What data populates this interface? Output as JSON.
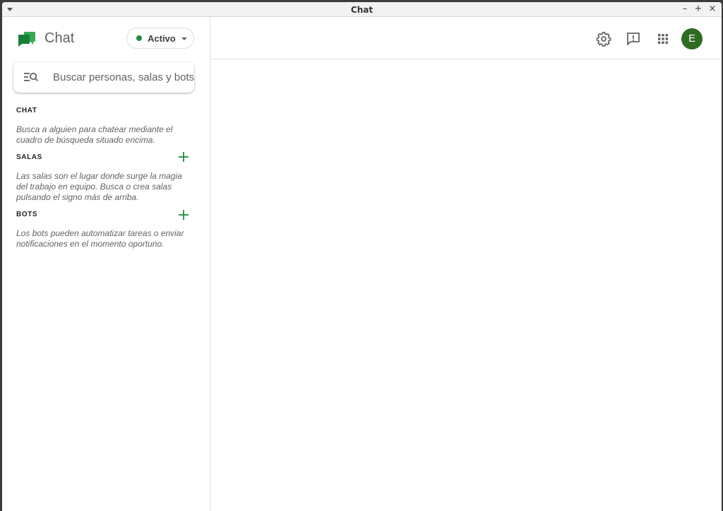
{
  "window": {
    "title": "Chat",
    "controls": {
      "minimize": "–",
      "maximize": "+",
      "close": "×"
    }
  },
  "app": {
    "name": "Chat",
    "brand_color": "#1e8e3e"
  },
  "status": {
    "label": "Activo",
    "color": "#1e8e3e"
  },
  "search": {
    "placeholder": "Buscar personas, salas y bots"
  },
  "sections": {
    "chat": {
      "title": "CHAT",
      "description": "Busca a alguien para chatear mediante el cuadro de búsqueda situado encima."
    },
    "salas": {
      "title": "SALAS",
      "description": "Las salas son el lugar donde surge la magia del trabajo en equipo. Busca o crea salas pulsando el signo más de arriba."
    },
    "bots": {
      "title": "BOTS",
      "description": "Los bots pueden automatizar tareas o enviar notificaciones en el momento oportuno."
    }
  },
  "topbar": {
    "icons": [
      "gear-icon",
      "feedback-icon",
      "apps-grid-icon"
    ],
    "avatar_initial": "E",
    "avatar_color": "#2e6b23"
  }
}
